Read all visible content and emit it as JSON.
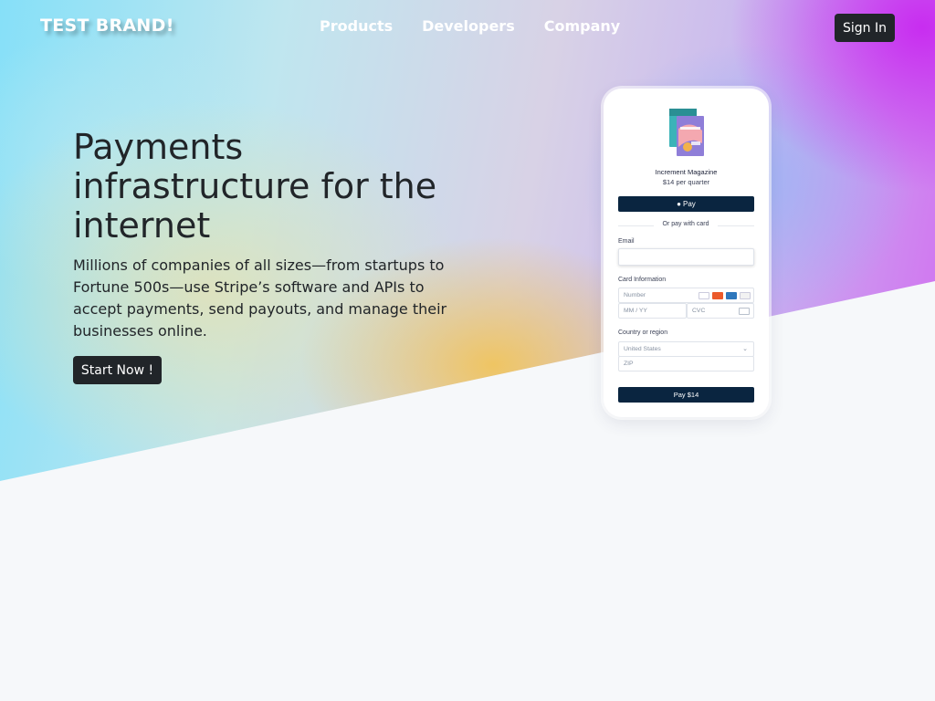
{
  "header": {
    "brand": "TEST BRAND!",
    "nav": [
      "Products",
      "Developers",
      "Company"
    ],
    "signin": "Sign In"
  },
  "hero": {
    "title": "Payments infrastructure for the internet",
    "description": "Millions of companies of all sizes—from startups to Fortune 500s—use Stripe’s software and APIs to accept payments, send payouts, and manage their businesses online.",
    "cta": "Start Now !"
  },
  "checkout": {
    "product_name": "Increment Magazine",
    "product_price": "$14 per quarter",
    "apple_pay_label": "Pay",
    "or_text": "Or pay with card",
    "email_label": "Email",
    "email_value": "",
    "card_label": "Card Information",
    "card_number_placeholder": "Number",
    "expiry_placeholder": "MM / YY",
    "cvc_placeholder": "CVC",
    "country_label": "Country or region",
    "country_value": "United States",
    "zip_placeholder": "ZIP",
    "pay_button": "Pay $14"
  },
  "colors": {
    "dark_button": "#212529",
    "checkout_navy": "#0a2540",
    "page_background": "#f6f8fa"
  },
  "icons": [
    "apple-icon",
    "visa-icon",
    "mastercard-icon",
    "amex-icon",
    "discover-icon",
    "cvc-card-icon",
    "chevron-down-icon"
  ]
}
